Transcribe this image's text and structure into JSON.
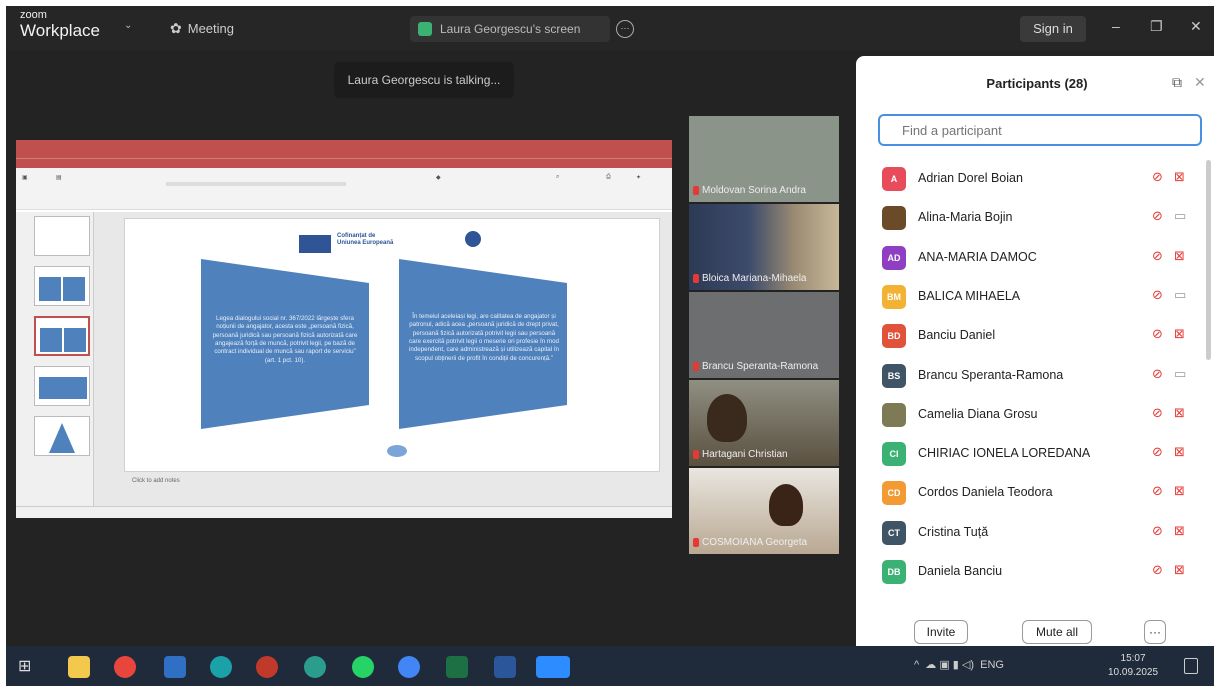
{
  "titlebar": {
    "brand_small": "zoom",
    "brand_large": "Workplace",
    "meeting_label": "Meeting",
    "share_label": "Laura Georgescu's screen",
    "signin_label": "Sign in",
    "minimize": "–",
    "restore": "❐",
    "close": "✕"
  },
  "talking_indicator": "Laura Georgescu is talking...",
  "slide": {
    "cofinantat_line1": "Cofinanțat de",
    "cofinantat_line2": "Uniunea Europeană",
    "left_text": "Legea dialogului social nr. 367/2022 lărgește sfera noțiunii de angajator, acesta este „persoană fizică, persoană juridică sau persoană fizică autorizată care angajează forță de muncă, potrivit legii, pe bază de contract individual de muncă sau raport de serviciu” (art. 1 pct. 10).",
    "right_text": "În temeiul aceleiași legi, are calitatea de angajator și patronul, adică acea „persoană juridică de drept privat, persoană fizică autorizată potrivit legii sau persoană care exercită potrivit legii o meserie ori profesie în mod independent, care administrează și utilizează capital în scopul obținerii de profit în condiții de concurență.”",
    "notes": "Click to add notes"
  },
  "video_tiles": [
    {
      "name": "Moldovan Sorina Andra"
    },
    {
      "name": "Bloica Mariana-Mihaela"
    },
    {
      "name": "Brancu Speranta-Ramona"
    },
    {
      "name": "Hartagani Christian"
    },
    {
      "name": "COSMOIANA Georgeta"
    }
  ],
  "participants": {
    "title": "Participants (28)",
    "search_placeholder": "Find a participant",
    "list": [
      {
        "initials": "A",
        "name": "Adrian Dorel Boian",
        "color": "#e84c5a",
        "camera": "off"
      },
      {
        "initials": "",
        "name": "Alina-Maria Bojin",
        "color": "#6b4a2a",
        "camera": "on"
      },
      {
        "initials": "AD",
        "name": "ANA-MARIA DAMOC",
        "color": "#8e3fc2",
        "camera": "off"
      },
      {
        "initials": "BM",
        "name": "BALICA MIHAELA",
        "color": "#f2b233",
        "camera": "on"
      },
      {
        "initials": "BD",
        "name": "Banciu Daniel",
        "color": "#e0533a",
        "camera": "off"
      },
      {
        "initials": "BS",
        "name": "Brancu Speranta-Ramona",
        "color": "#3f5566",
        "camera": "on"
      },
      {
        "initials": "",
        "name": "Camelia Diana Grosu",
        "color": "#7d7a55",
        "camera": "off"
      },
      {
        "initials": "CI",
        "name": "CHIRIAC IONELA LOREDANA",
        "color": "#3bb273",
        "camera": "off"
      },
      {
        "initials": "CD",
        "name": "Cordos Daniela Teodora",
        "color": "#f29a33",
        "camera": "off"
      },
      {
        "initials": "CT",
        "name": "Cristina Tuță",
        "color": "#3f5566",
        "camera": "off"
      },
      {
        "initials": "DB",
        "name": "Daniela Banciu",
        "color": "#3bb273",
        "camera": "off"
      }
    ],
    "invite_label": "Invite",
    "mute_all_label": "Mute all",
    "more_label": "···"
  },
  "taskbar": {
    "tray_lang": "ENG",
    "time": "15:07",
    "date": "10.09.2025"
  }
}
